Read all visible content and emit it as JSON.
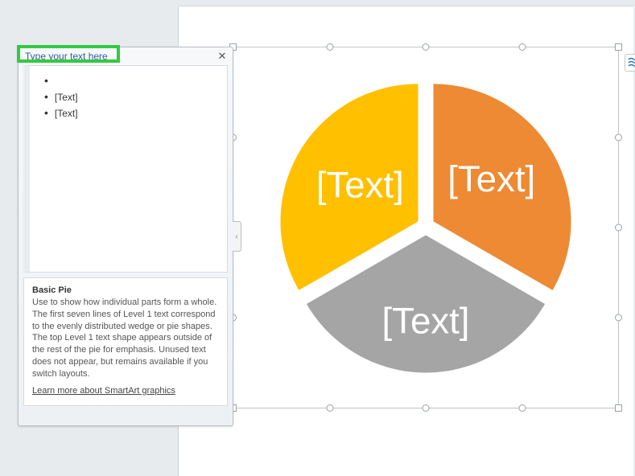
{
  "text_pane": {
    "header": "Type your text here",
    "close_glyph": "✕",
    "items": [
      "",
      "[Text]",
      "[Text]"
    ],
    "desc_title": "Basic Pie",
    "desc_body": "Use to show how individual parts form a whole. The first seven lines of Level 1 text correspond to the evenly distributed wedge or pie shapes. The top Level 1 text shape appears outside of the rest of the pie for emphasis. Unused text does not appear, but remains available if you switch layouts.",
    "learn_link": "Learn more about SmartArt graphics",
    "tab_glyph": "‹"
  },
  "chart_data": {
    "type": "pie",
    "title": "",
    "slices": [
      {
        "label": "[Text]",
        "value": 1,
        "color": "#ED8A33"
      },
      {
        "label": "[Text]",
        "value": 1,
        "color": "#A5A5A5"
      },
      {
        "label": "[Text]",
        "value": 1,
        "color": "#FFC000"
      }
    ]
  }
}
